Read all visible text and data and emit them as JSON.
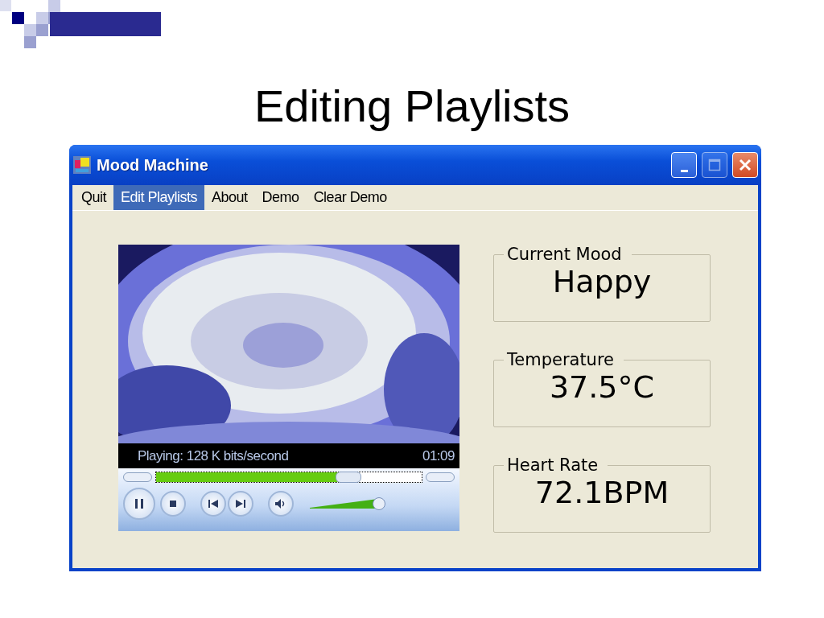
{
  "slide": {
    "title": "Editing Playlists"
  },
  "window": {
    "title": "Mood Machine",
    "buttons": [
      {
        "kind": "minimize",
        "disabled": false
      },
      {
        "kind": "maximize",
        "disabled": true
      },
      {
        "kind": "close",
        "disabled": false
      }
    ]
  },
  "menu": [
    {
      "label": "Quit",
      "selected": false
    },
    {
      "label": "Edit Playlists",
      "selected": true
    },
    {
      "label": "About",
      "selected": false
    },
    {
      "label": "Demo",
      "selected": false
    },
    {
      "label": "Clear Demo",
      "selected": false
    }
  ],
  "player": {
    "status": "Playing: 128 K bits/second",
    "time": "01:09",
    "seek": {
      "level": 0.72
    },
    "volume": {
      "level": 0.92
    },
    "playing": true
  },
  "readouts": [
    {
      "label": "Current Mood",
      "value": "Happy"
    },
    {
      "label": "Temperature",
      "value": "37.5°C"
    },
    {
      "label": "Heart Rate",
      "value": "72.1BPM"
    }
  ]
}
